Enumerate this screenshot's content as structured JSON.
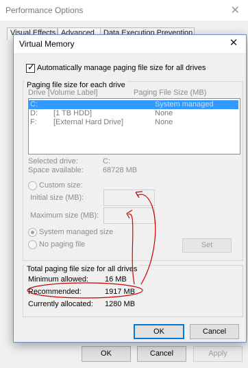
{
  "parent": {
    "title": "Performance Options",
    "tabs": [
      "Visual Effects",
      "Advanced",
      "Data Execution Prevention"
    ],
    "buttons": {
      "ok": "OK",
      "cancel": "Cancel",
      "apply": "Apply"
    }
  },
  "dialog": {
    "title": "Virtual Memory",
    "auto_manage_label": "Automatically manage paging file size for all drives",
    "auto_manage_checked": true,
    "paging_group_title": "Paging file size for each drive",
    "col_drive": "Drive  [Volume Label]",
    "col_size": "Paging File Size (MB)",
    "drives": [
      {
        "drive": "C:",
        "label": "",
        "size": "System managed",
        "selected": true
      },
      {
        "drive": "D:",
        "label": "[1 TB HDD]",
        "size": "None",
        "selected": false
      },
      {
        "drive": "F:",
        "label": "[External Hard Drive]",
        "size": "None",
        "selected": false
      }
    ],
    "selected_drive_label": "Selected drive:",
    "selected_drive_value": "C:",
    "space_available_label": "Space available:",
    "space_available_value": "68728 MB",
    "custom_size_label": "Custom size:",
    "initial_size_label": "Initial size (MB):",
    "maximum_size_label": "Maximum size (MB):",
    "system_managed_label": "System managed size",
    "no_paging_label": "No paging file",
    "set_button": "Set",
    "total_group_title": "Total paging file size for all drives",
    "totals": [
      {
        "label": "Minimum allowed:",
        "value": "16 MB"
      },
      {
        "label": "Recommended:",
        "value": "1917 MB"
      },
      {
        "label": "Currently allocated:",
        "value": "1280 MB"
      }
    ],
    "ok_button": "OK",
    "cancel_button": "Cancel"
  },
  "colors": {
    "selection": "#3399ff",
    "annotation": "#cc0000",
    "default_button_border": "#0078d7"
  }
}
